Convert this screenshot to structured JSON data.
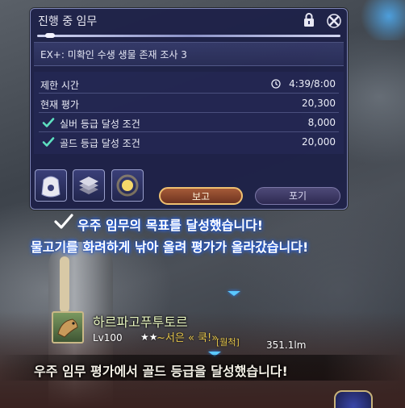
{
  "quest_window": {
    "title": "진행 중 임무",
    "subtitle": "EX+: 미확인 수생 생물 존재 조사 3",
    "rows": [
      {
        "label": "제한 시간",
        "value": "4:39/8:00",
        "icon": "clock-icon"
      },
      {
        "label": "현재 평가",
        "value": "20,300"
      },
      {
        "label": "실버 등급 달성 조건",
        "value": "8,000",
        "icon": "check-icon"
      },
      {
        "label": "골드 등급 달성 조건",
        "value": "20,000",
        "icon": "check-icon"
      }
    ],
    "report_label": "보고",
    "giveup_label": "포기"
  },
  "notifications": {
    "line1": "우주 임무의 목표를 달성했습니다!",
    "line2": "물고기를 화려하게 낚아 올려 평가가 올라갔습니다!",
    "line3": "우주 임무 평가에서 골드 등급을 달성했습니다!"
  },
  "enemy": {
    "name": "하르파고푸투토르",
    "level": "Lv100",
    "stars": "★★",
    "overlay": "~서은 « 쿡!»",
    "tag": "[월척]",
    "distance": "351.1lm"
  },
  "colors": {
    "window_bg": "#1c2048",
    "report_border": "#f0c070",
    "notice_glow": "#2a6cff",
    "enemy_name": "#e8f6c0"
  }
}
